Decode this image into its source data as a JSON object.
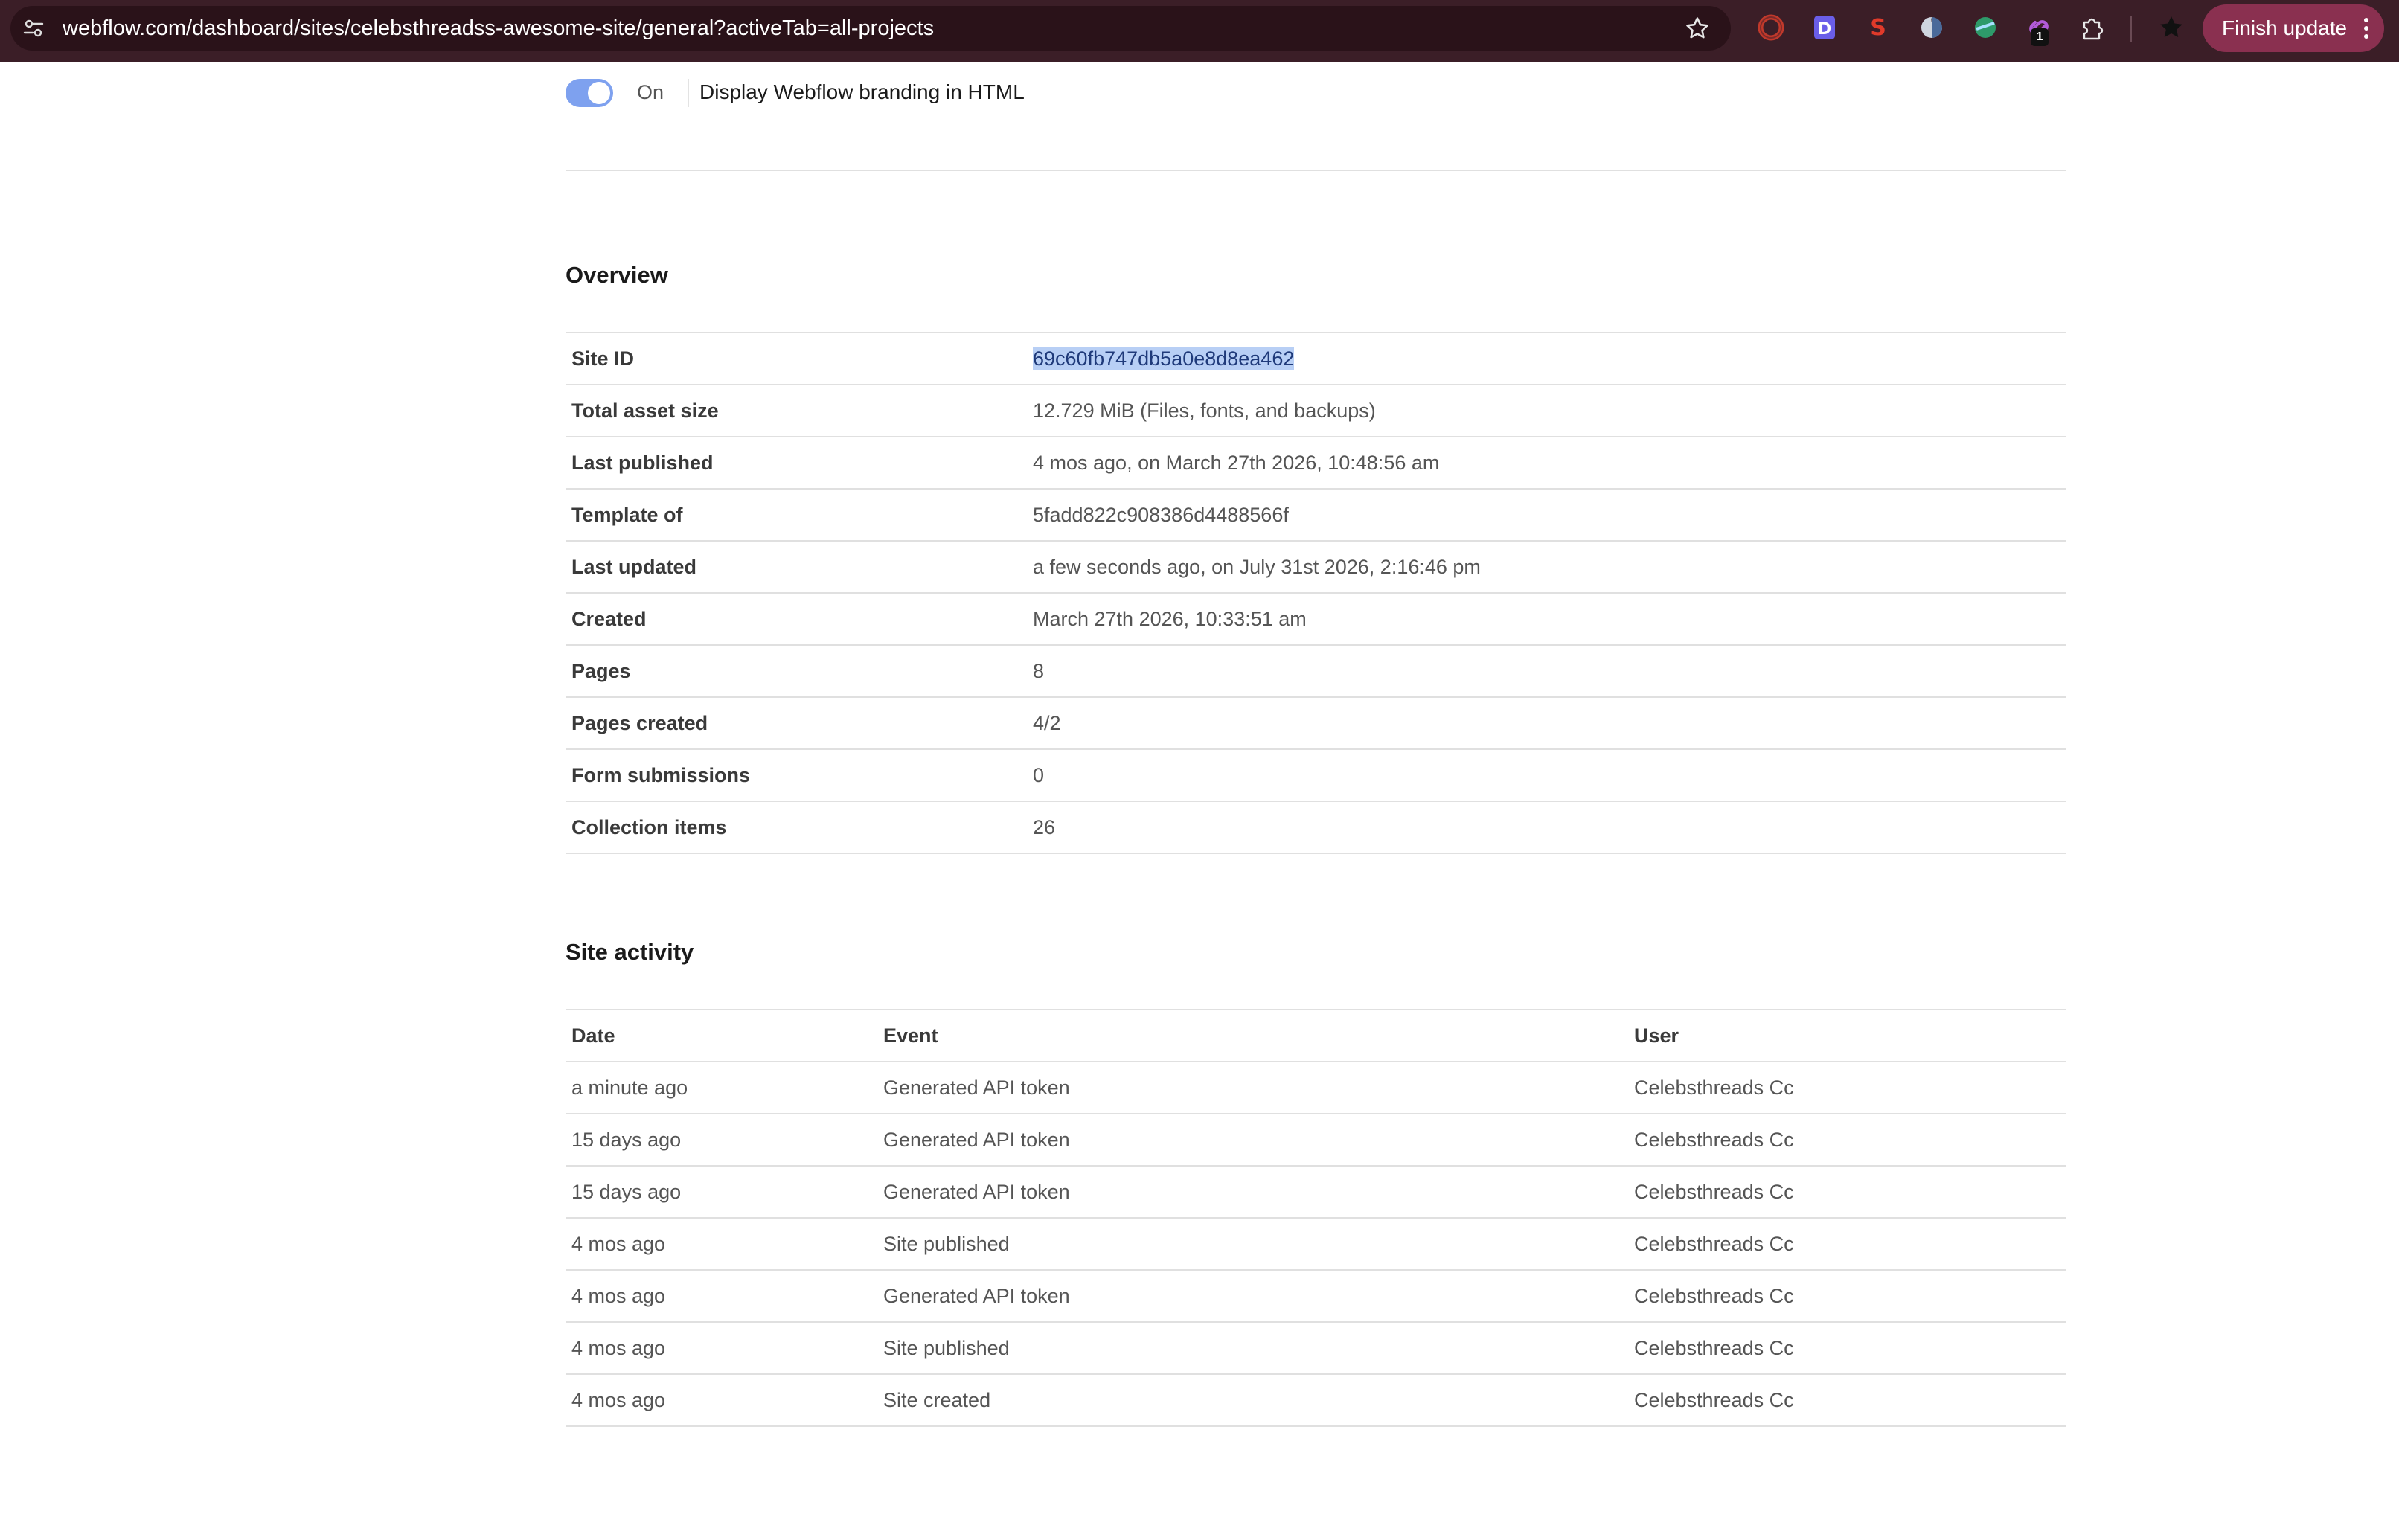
{
  "browser": {
    "url": "webflow.com/dashboard/sites/celebsthreadss-awesome-site/general?activeTab=all-projects",
    "finish_update_label": "Finish update",
    "extension_badge": "1",
    "extensions": [
      "red-ring-extension-icon",
      "d-extension-icon",
      "s-extension-icon",
      "half-moon-extension-icon",
      "green-globe-extension-icon",
      "purple-link-extension-icon",
      "puzzle-extensions-icon",
      "star-bookmark-extension-icon"
    ]
  },
  "branding": {
    "toggle_state": "On",
    "label": "Display Webflow branding in HTML"
  },
  "overview": {
    "title": "Overview",
    "rows": [
      {
        "key": "Site ID",
        "value": "69c60fb747db5a0e8d8ea462"
      },
      {
        "key": "Total asset size",
        "value": "12.729 MiB (Files, fonts, and backups)"
      },
      {
        "key": "Last published",
        "value": "4 mos ago, on March 27th 2026, 10:48:56 am"
      },
      {
        "key": "Template of",
        "value": "5fadd822c908386d4488566f"
      },
      {
        "key": "Last updated",
        "value": "a few seconds ago, on July 31st 2026, 2:16:46 pm"
      },
      {
        "key": "Created",
        "value": "March 27th 2026, 10:33:51 am"
      },
      {
        "key": "Pages",
        "value": "8"
      },
      {
        "key": "Pages created",
        "value": "4/2"
      },
      {
        "key": "Form submissions",
        "value": "0"
      },
      {
        "key": "Collection items",
        "value": "26"
      }
    ]
  },
  "activity": {
    "title": "Site activity",
    "headers": {
      "date": "Date",
      "event": "Event",
      "user": "User"
    },
    "rows": [
      {
        "date": "a minute ago",
        "event": "Generated API token",
        "user": "Celebsthreads Cc"
      },
      {
        "date": "15 days ago",
        "event": "Generated API token",
        "user": "Celebsthreads Cc"
      },
      {
        "date": "15 days ago",
        "event": "Generated API token",
        "user": "Celebsthreads Cc"
      },
      {
        "date": "4 mos ago",
        "event": "Site published",
        "user": "Celebsthreads Cc"
      },
      {
        "date": "4 mos ago",
        "event": "Generated API token",
        "user": "Celebsthreads Cc"
      },
      {
        "date": "4 mos ago",
        "event": "Site published",
        "user": "Celebsthreads Cc"
      },
      {
        "date": "4 mos ago",
        "event": "Site created",
        "user": "Celebsthreads Cc"
      }
    ]
  },
  "colors": {
    "toolbar_bg": "#3b1e27",
    "omnibox_bg": "#2a1219",
    "finish_update_bg": "#8a3050",
    "toggle_on": "#7ea1ef",
    "selection": "#b8cff5"
  }
}
